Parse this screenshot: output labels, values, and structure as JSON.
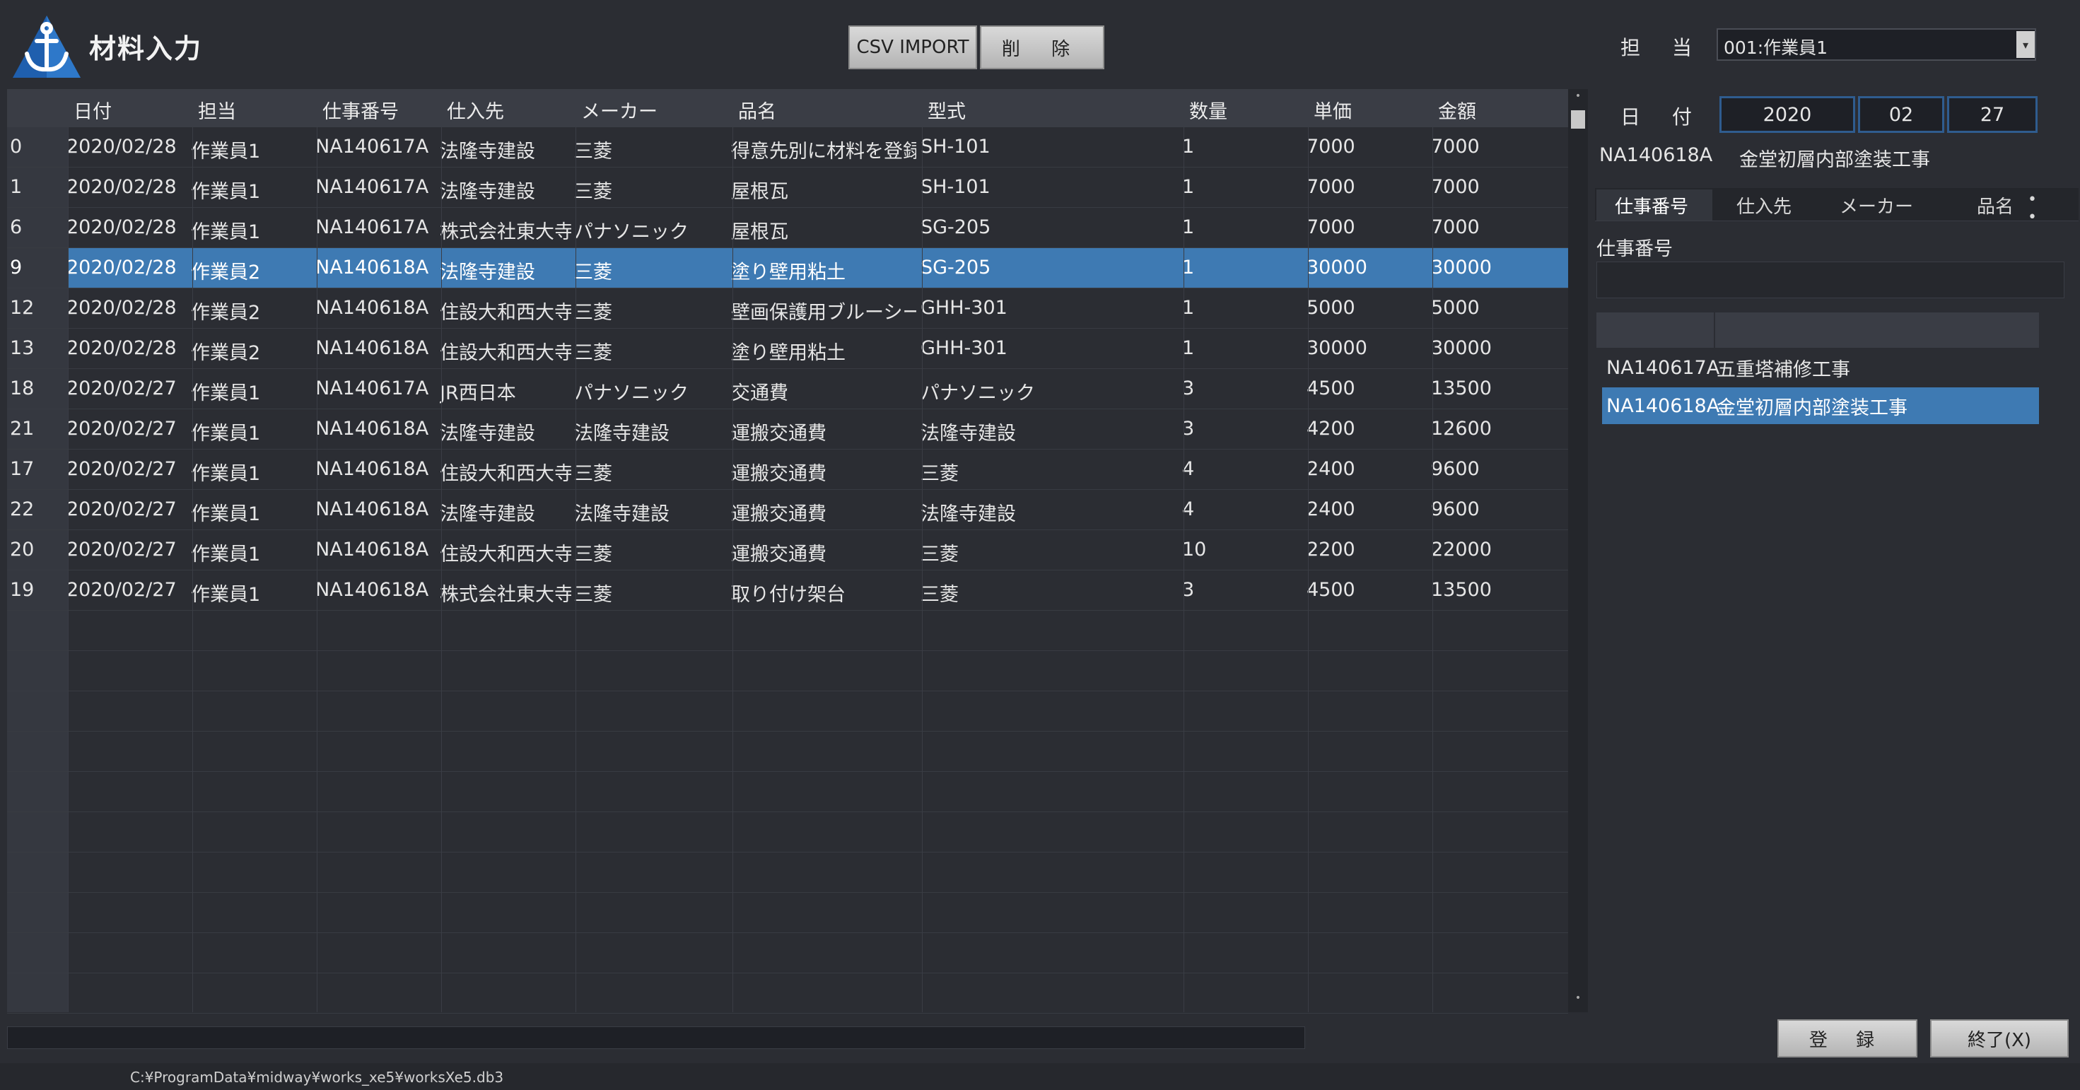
{
  "app": {
    "title": "材料入力"
  },
  "toolbar": {
    "csv_label": "CSV IMPORT",
    "delete_label": "削 除"
  },
  "form": {
    "tanto_label": "担 当",
    "tanto_value": "001:作業員1",
    "date_label": "日 付",
    "year": "2020",
    "month": "02",
    "day": "27",
    "job_code": "NA140618A",
    "job_name": "金堂初層内部塗装工事"
  },
  "tabs": {
    "job": "仕事番号",
    "supplier": "仕入先",
    "maker": "メーカー",
    "product": "品名",
    "more": "• •"
  },
  "filter": {
    "label": "仕事番号",
    "value": ""
  },
  "right_list": [
    {
      "code": "NA140617A",
      "name": "五重塔補修工事",
      "selected": false
    },
    {
      "code": "NA140618A",
      "name": "金堂初層内部塗装工事",
      "selected": true
    }
  ],
  "grid": {
    "headers": [
      "日付",
      "担当",
      "仕事番号",
      "仕入先",
      "メーカー",
      "品名",
      "型式",
      "数量",
      "単価",
      "金額"
    ],
    "rows": [
      {
        "id": "0",
        "date": "2020/02/28",
        "tanto": "作業員1",
        "job": "NA140617A",
        "supplier": "法隆寺建設",
        "maker": "三菱",
        "product": "得意先別に材料を登録",
        "model": "SH-101",
        "qty": "1",
        "price": "7000",
        "amount": "7000"
      },
      {
        "id": "1",
        "date": "2020/02/28",
        "tanto": "作業員1",
        "job": "NA140617A",
        "supplier": "法隆寺建設",
        "maker": "三菱",
        "product": "屋根瓦",
        "model": "SH-101",
        "qty": "1",
        "price": "7000",
        "amount": "7000"
      },
      {
        "id": "6",
        "date": "2020/02/28",
        "tanto": "作業員1",
        "job": "NA140617A",
        "supplier": "株式会社東大寺",
        "maker": "パナソニック",
        "product": "屋根瓦",
        "model": "SG-205",
        "qty": "1",
        "price": "7000",
        "amount": "7000"
      },
      {
        "id": "9",
        "date": "2020/02/28",
        "tanto": "作業員2",
        "job": "NA140618A",
        "supplier": "法隆寺建設",
        "maker": "三菱",
        "product": "塗り壁用粘土",
        "model": "SG-205",
        "qty": "1",
        "price": "30000",
        "amount": "30000",
        "selected": true
      },
      {
        "id": "12",
        "date": "2020/02/28",
        "tanto": "作業員2",
        "job": "NA140618A",
        "supplier": "住設大和西大寺",
        "maker": "三菱",
        "product": "壁画保護用ブルーシート",
        "model": "GHH-301",
        "qty": "1",
        "price": "5000",
        "amount": "5000"
      },
      {
        "id": "13",
        "date": "2020/02/28",
        "tanto": "作業員2",
        "job": "NA140618A",
        "supplier": "住設大和西大寺",
        "maker": "三菱",
        "product": "塗り壁用粘土",
        "model": "GHH-301",
        "qty": "1",
        "price": "30000",
        "amount": "30000"
      },
      {
        "id": "18",
        "date": "2020/02/27",
        "tanto": "作業員1",
        "job": "NA140617A",
        "supplier": "JR西日本",
        "maker": "パナソニック",
        "product": "交通費",
        "model": "パナソニック",
        "qty": "3",
        "price": "4500",
        "amount": "13500"
      },
      {
        "id": "21",
        "date": "2020/02/27",
        "tanto": "作業員1",
        "job": "NA140618A",
        "supplier": "法隆寺建設",
        "maker": "法隆寺建設",
        "product": "運搬交通費",
        "model": "法隆寺建設",
        "qty": "3",
        "price": "4200",
        "amount": "12600"
      },
      {
        "id": "17",
        "date": "2020/02/27",
        "tanto": "作業員1",
        "job": "NA140618A",
        "supplier": "住設大和西大寺",
        "maker": "三菱",
        "product": "運搬交通費",
        "model": "三菱",
        "qty": "4",
        "price": "2400",
        "amount": "9600"
      },
      {
        "id": "22",
        "date": "2020/02/27",
        "tanto": "作業員1",
        "job": "NA140618A",
        "supplier": "法隆寺建設",
        "maker": "法隆寺建設",
        "product": "運搬交通費",
        "model": "法隆寺建設",
        "qty": "4",
        "price": "2400",
        "amount": "9600"
      },
      {
        "id": "20",
        "date": "2020/02/27",
        "tanto": "作業員1",
        "job": "NA140618A",
        "supplier": "住設大和西大寺",
        "maker": "三菱",
        "product": "運搬交通費",
        "model": "三菱",
        "qty": "10",
        "price": "2200",
        "amount": "22000"
      },
      {
        "id": "19",
        "date": "2020/02/27",
        "tanto": "作業員1",
        "job": "NA140618A",
        "supplier": "株式会社東大寺",
        "maker": "三菱",
        "product": "取り付け架台",
        "model": "三菱",
        "qty": "3",
        "price": "4500",
        "amount": "13500"
      }
    ]
  },
  "footer": {
    "register_label": "登 録",
    "exit_label": "終了(X)",
    "status_path": "C:¥ProgramData¥midway¥works_xe5¥worksXe5.db3"
  },
  "colors": {
    "background": "#2b2d33",
    "selection": "#3e7ab3",
    "header": "#3a3d45"
  }
}
